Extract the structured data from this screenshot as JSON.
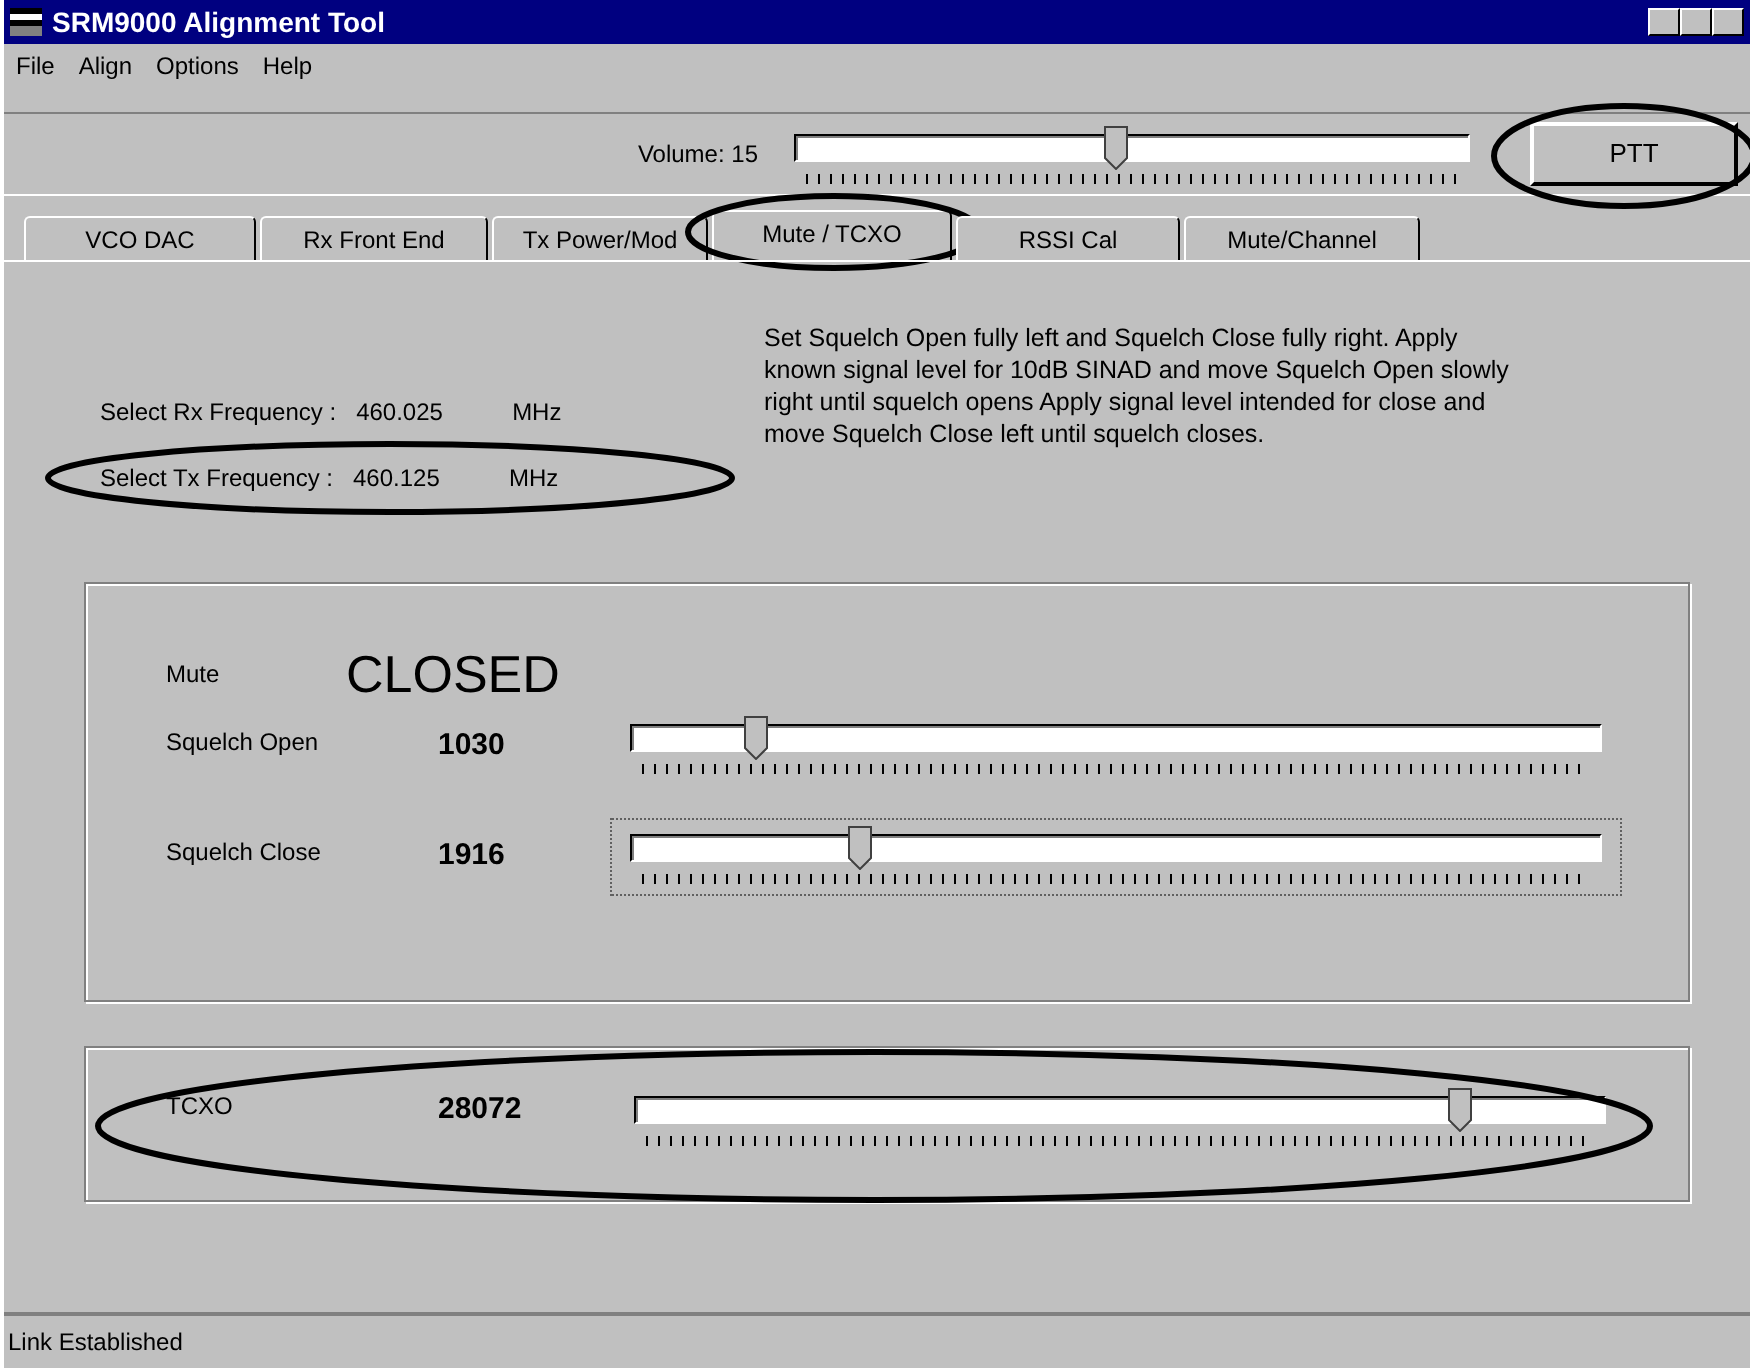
{
  "window": {
    "title": "SRM9000 Alignment Tool"
  },
  "menu": [
    {
      "label": "File"
    },
    {
      "label": "Align"
    },
    {
      "label": "Options"
    },
    {
      "label": "Help"
    }
  ],
  "toolbar": {
    "volume_label": "Volume: 15",
    "volume": {
      "level": 0.475
    },
    "ptt": {
      "label": "PTT",
      "circled": true
    }
  },
  "tabs": [
    {
      "label": "VCO DAC",
      "selected": false,
      "circled": false
    },
    {
      "label": "Rx Front End",
      "selected": false,
      "circled": false
    },
    {
      "label": "Tx Power/Mod",
      "selected": false,
      "circled": false
    },
    {
      "label": "Mute / TCXO",
      "selected": true,
      "circled": true
    },
    {
      "label": "RSSI Cal",
      "selected": false,
      "circled": false
    },
    {
      "label": "Mute/Channel",
      "selected": false,
      "circled": false
    }
  ],
  "frequencies": [
    {
      "label": "Select Rx Frequency :",
      "value": "460.025",
      "unit": "MHz",
      "circled": false
    },
    {
      "label": "Select Tx Frequency :",
      "value": "460.125",
      "unit": "MHz",
      "circled": true
    }
  ],
  "instructions": "Set Squelch Open fully left and Squelch Close fully right.  Apply known signal level for 10dB SINAD and move Squelch Open slowly right until squelch opens  Apply signal level intended for close and move Squelch Close left until squelch closes.",
  "mute": {
    "label": "Mute",
    "status": "CLOSED"
  },
  "squelch": [
    {
      "label": "Squelch Open",
      "value": "1030",
      "level": 0.13,
      "focused": false
    },
    {
      "label": "Squelch Close",
      "value": "1916",
      "level": 0.237,
      "focused": true
    }
  ],
  "tcxo": {
    "label": "TCXO",
    "value": "28072",
    "level": 0.85,
    "circled": true
  },
  "status_bar": "Link Established"
}
